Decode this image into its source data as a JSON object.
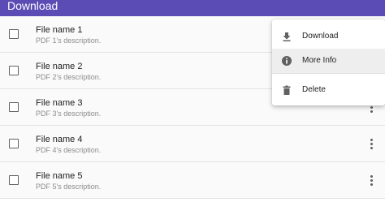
{
  "appbar": {
    "title": "Download"
  },
  "files": [
    {
      "name": "File name 1",
      "description": "PDF 1's description."
    },
    {
      "name": "File name 2",
      "description": "PDF 2's description."
    },
    {
      "name": "File name 3",
      "description": "PDF 3's description."
    },
    {
      "name": "File name 4",
      "description": "PDF 4's description."
    },
    {
      "name": "File name 5",
      "description": "PDF 5's description."
    }
  ],
  "menu": {
    "items": [
      {
        "label": "Download",
        "icon": "download-icon"
      },
      {
        "label": "More Info",
        "icon": "info-icon"
      },
      {
        "label": "Delete",
        "icon": "delete-icon"
      }
    ]
  },
  "colors": {
    "appbar": "#5b4bb5",
    "highlight": "#eeeeee"
  }
}
